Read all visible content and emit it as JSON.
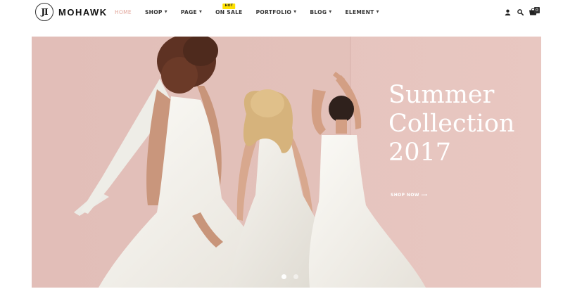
{
  "brand": {
    "logo_mark": "JI",
    "name": "MOHAWK"
  },
  "nav": {
    "items": [
      {
        "label": "HOME",
        "active": true,
        "dropdown": false
      },
      {
        "label": "SHOP",
        "active": false,
        "dropdown": true
      },
      {
        "label": "PAGE",
        "active": false,
        "dropdown": true
      },
      {
        "label": "ON SALE",
        "active": false,
        "dropdown": false,
        "badge": "HOT"
      },
      {
        "label": "PORTFOLIO",
        "active": false,
        "dropdown": true
      },
      {
        "label": "BLOG",
        "active": false,
        "dropdown": true
      },
      {
        "label": "ELEMENT",
        "active": false,
        "dropdown": true
      }
    ],
    "caret_glyph": "▼"
  },
  "tools": {
    "user_icon": "user-icon",
    "search_icon": "search-icon",
    "cart_icon": "cart-icon",
    "cart_count": "0"
  },
  "hero": {
    "title_line1": "Summer",
    "title_line2": "Collection",
    "title_line3": "2017",
    "cta": "SHOP NOW ⟶",
    "slides_total": 2,
    "active_slide": 1
  },
  "colors": {
    "accent": "#e2a59a",
    "hot_badge": "#ffe100",
    "hero_bg": "#e6c4be"
  }
}
